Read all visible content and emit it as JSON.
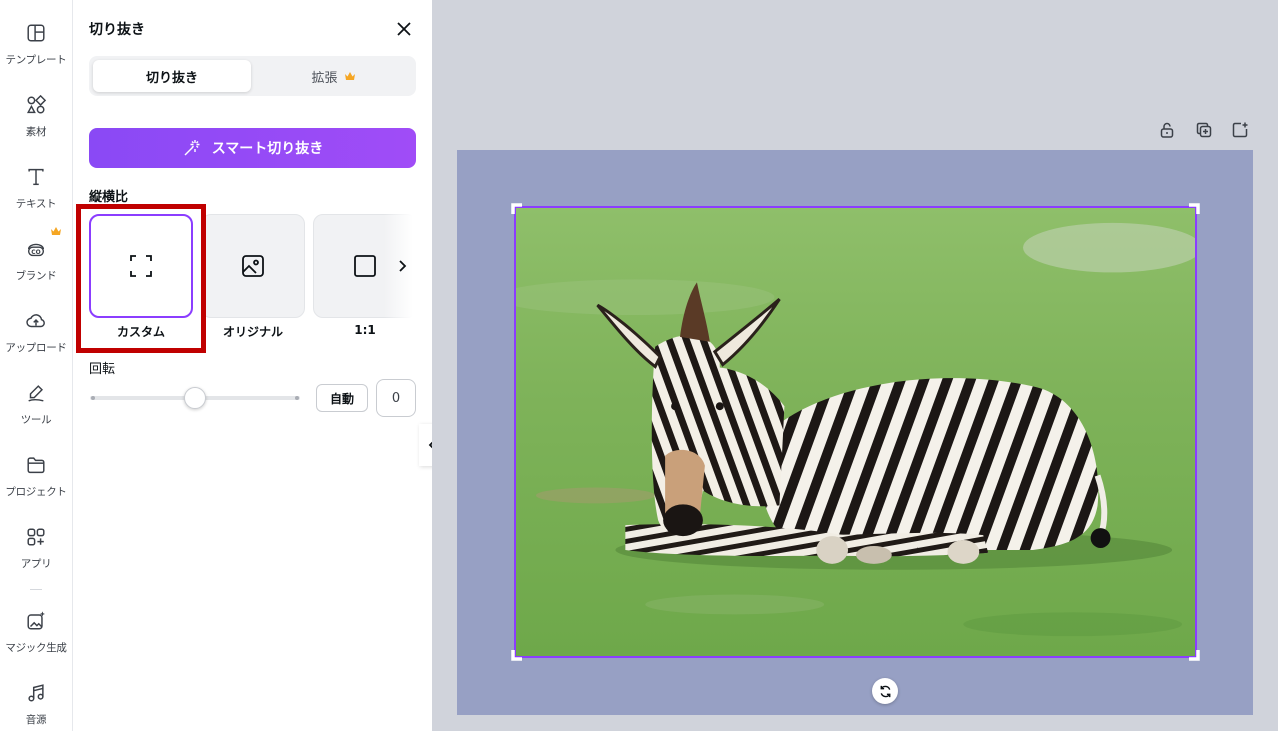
{
  "rail": {
    "items": [
      {
        "label": "テンプレート",
        "icon": "template-icon"
      },
      {
        "label": "素材",
        "icon": "elements-icon"
      },
      {
        "label": "テキスト",
        "icon": "text-icon"
      },
      {
        "label": "ブランド",
        "icon": "brand-icon"
      },
      {
        "label": "アップロード",
        "icon": "upload-icon"
      },
      {
        "label": "ツール",
        "icon": "draw-tool-icon"
      },
      {
        "label": "プロジェクト",
        "icon": "folder-icon"
      },
      {
        "label": "アプリ",
        "icon": "apps-icon"
      },
      {
        "label": "マジック生成",
        "icon": "magic-media-icon"
      },
      {
        "label": "音源",
        "icon": "music-icon"
      }
    ]
  },
  "panel": {
    "title": "切り抜き",
    "tabs": [
      {
        "label": "切り抜き",
        "active": true
      },
      {
        "label": "拡張",
        "active": false,
        "premium": true
      }
    ],
    "smart_crop_label": "スマート切り抜き",
    "aspect_label": "縦横比",
    "ratios": [
      {
        "label": "カスタム",
        "icon": "custom-crop-icon",
        "selected": true
      },
      {
        "label": "オリジナル",
        "icon": "image-icon",
        "selected": false
      },
      {
        "label": "1:1",
        "icon": "square-icon",
        "selected": false
      }
    ],
    "rotation_label": "回転",
    "rotation_auto_label": "自動",
    "rotation_value": "0"
  },
  "colors": {
    "accent": "#8b3dff",
    "button_gradient_start": "#8a49f5",
    "button_gradient_end": "#a04cf7",
    "canvas_bg": "#d0d3db",
    "page_bg": "#97a0c4",
    "highlight": "#c00000",
    "crown": "#f5a623"
  },
  "canvas": {
    "image_subject": "zebra lying on grass"
  }
}
